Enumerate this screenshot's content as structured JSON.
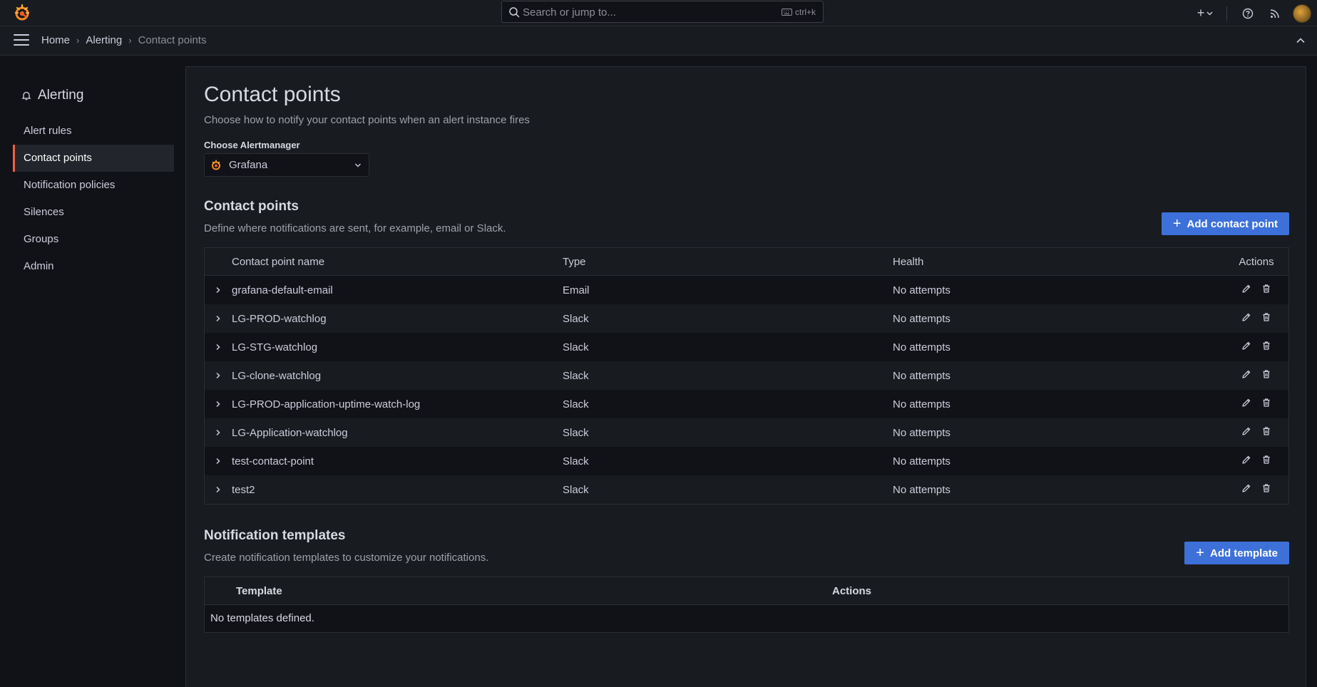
{
  "topbar": {
    "search_placeholder": "Search or jump to...",
    "search_shortcut": "ctrl+k",
    "add_label": "+"
  },
  "breadcrumb": [
    "Home",
    "Alerting",
    "Contact points"
  ],
  "sidebar": {
    "title": "Alerting",
    "items": [
      {
        "label": "Alert rules",
        "active": false
      },
      {
        "label": "Contact points",
        "active": true
      },
      {
        "label": "Notification policies",
        "active": false
      },
      {
        "label": "Silences",
        "active": false
      },
      {
        "label": "Groups",
        "active": false
      },
      {
        "label": "Admin",
        "active": false
      }
    ]
  },
  "page": {
    "title": "Contact points",
    "description": "Choose how to notify your contact points when an alert instance fires",
    "alertmanager_label": "Choose Alertmanager",
    "alertmanager_value": "Grafana"
  },
  "contact_points": {
    "title": "Contact points",
    "description": "Define where notifications are sent, for example, email or Slack.",
    "add_button": "Add contact point",
    "columns": {
      "name": "Contact point name",
      "type": "Type",
      "health": "Health",
      "actions": "Actions"
    },
    "rows": [
      {
        "name": "grafana-default-email",
        "type": "Email",
        "health": "No attempts"
      },
      {
        "name": "LG-PROD-watchlog",
        "type": "Slack",
        "health": "No attempts"
      },
      {
        "name": "LG-STG-watchlog",
        "type": "Slack",
        "health": "No attempts"
      },
      {
        "name": "LG-clone-watchlog",
        "type": "Slack",
        "health": "No attempts"
      },
      {
        "name": "LG-PROD-application-uptime-watch-log",
        "type": "Slack",
        "health": "No attempts"
      },
      {
        "name": "LG-Application-watchlog",
        "type": "Slack",
        "health": "No attempts"
      },
      {
        "name": "test-contact-point",
        "type": "Slack",
        "health": "No attempts"
      },
      {
        "name": "test2",
        "type": "Slack",
        "health": "No attempts"
      }
    ]
  },
  "templates": {
    "title": "Notification templates",
    "description": "Create notification templates to customize your notifications.",
    "add_button": "Add template",
    "columns": {
      "template": "Template",
      "actions": "Actions"
    },
    "empty_text": "No templates defined."
  },
  "colors": {
    "accent": "#f55f3e",
    "primary_button": "#3d71d9",
    "background": "#111217",
    "panel": "#181b1f"
  }
}
